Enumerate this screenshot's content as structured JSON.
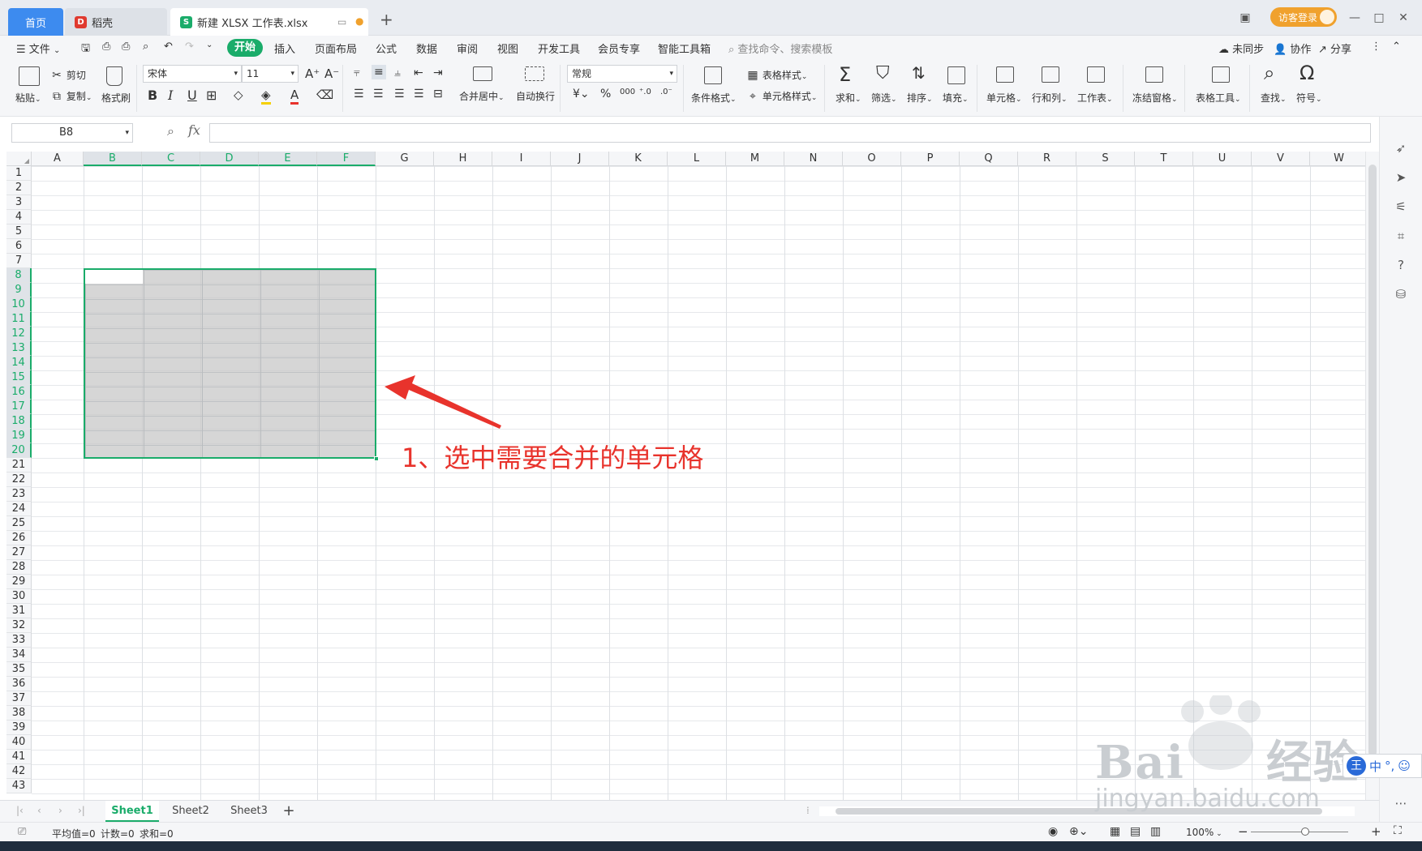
{
  "titlebar": {
    "tab_home": "首页",
    "tab_daoke": "稻壳",
    "tab_file": "新建 XLSX 工作表.xlsx",
    "new_tab": "+",
    "guest_login": "访客登录"
  },
  "menubar": {
    "file_menu": "文件",
    "tabs": [
      "开始",
      "插入",
      "页面布局",
      "公式",
      "数据",
      "审阅",
      "视图",
      "开发工具",
      "会员专享",
      "智能工具箱"
    ],
    "search_placeholder": "查找命令、搜索模板",
    "unsynced": "未同步",
    "collaborate": "协作",
    "share": "分享"
  },
  "ribbon": {
    "paste": "粘贴",
    "cut": "剪切",
    "copy": "复制",
    "format_painter": "格式刷",
    "font_name": "宋体",
    "font_size": "11",
    "merge_center": "合并居中",
    "wrap_text": "自动换行",
    "number_format": "常规",
    "conditional_format": "条件格式",
    "table_style": "表格样式",
    "cell_style": "单元格样式",
    "sum": "求和",
    "filter": "筛选",
    "sort": "排序",
    "fill": "填充",
    "cells": "单元格",
    "rows_cols": "行和列",
    "worksheet": "工作表",
    "freeze_panes": "冻结窗格",
    "table_tools": "表格工具",
    "find": "查找",
    "symbol": "符号"
  },
  "formulabar": {
    "name_box": "B8",
    "fx_label": "fx",
    "formula_value": ""
  },
  "grid": {
    "columns": [
      "A",
      "B",
      "C",
      "D",
      "E",
      "F",
      "G",
      "H",
      "I",
      "J",
      "K",
      "L",
      "M",
      "N",
      "O",
      "P",
      "Q",
      "R",
      "S",
      "T",
      "U",
      "V",
      "W"
    ],
    "rows": [
      "1",
      "2",
      "3",
      "4",
      "5",
      "6",
      "7",
      "8",
      "9",
      "10",
      "11",
      "12",
      "13",
      "14",
      "15",
      "16",
      "17",
      "18",
      "19",
      "20",
      "21",
      "22",
      "23",
      "24",
      "25",
      "26",
      "27",
      "28",
      "29",
      "30",
      "31",
      "32",
      "33",
      "34",
      "35",
      "36",
      "37",
      "38",
      "39",
      "40",
      "41",
      "42",
      "43"
    ],
    "selected_columns": [
      "B",
      "C",
      "D",
      "E",
      "F"
    ],
    "selected_rows": [
      "8",
      "9",
      "10",
      "11",
      "12",
      "13",
      "14",
      "15",
      "16",
      "17",
      "18",
      "19",
      "20"
    ],
    "accent_color": "#1aac6a"
  },
  "sheets": {
    "tabs": [
      "Sheet1",
      "Sheet2",
      "Sheet3"
    ],
    "active": "Sheet1",
    "add": "+"
  },
  "statusbar": {
    "average": "平均值=0",
    "count": "计数=0",
    "sum": "求和=0",
    "zoom": "100%"
  },
  "annotation": {
    "text": "1、选中需要合并的单元格",
    "color": "#e8332c"
  },
  "watermark": {
    "brand": "Bai",
    "brand_suffix": "经验",
    "url": "jingyan.baidu.com"
  },
  "ime": {
    "label": "中"
  }
}
